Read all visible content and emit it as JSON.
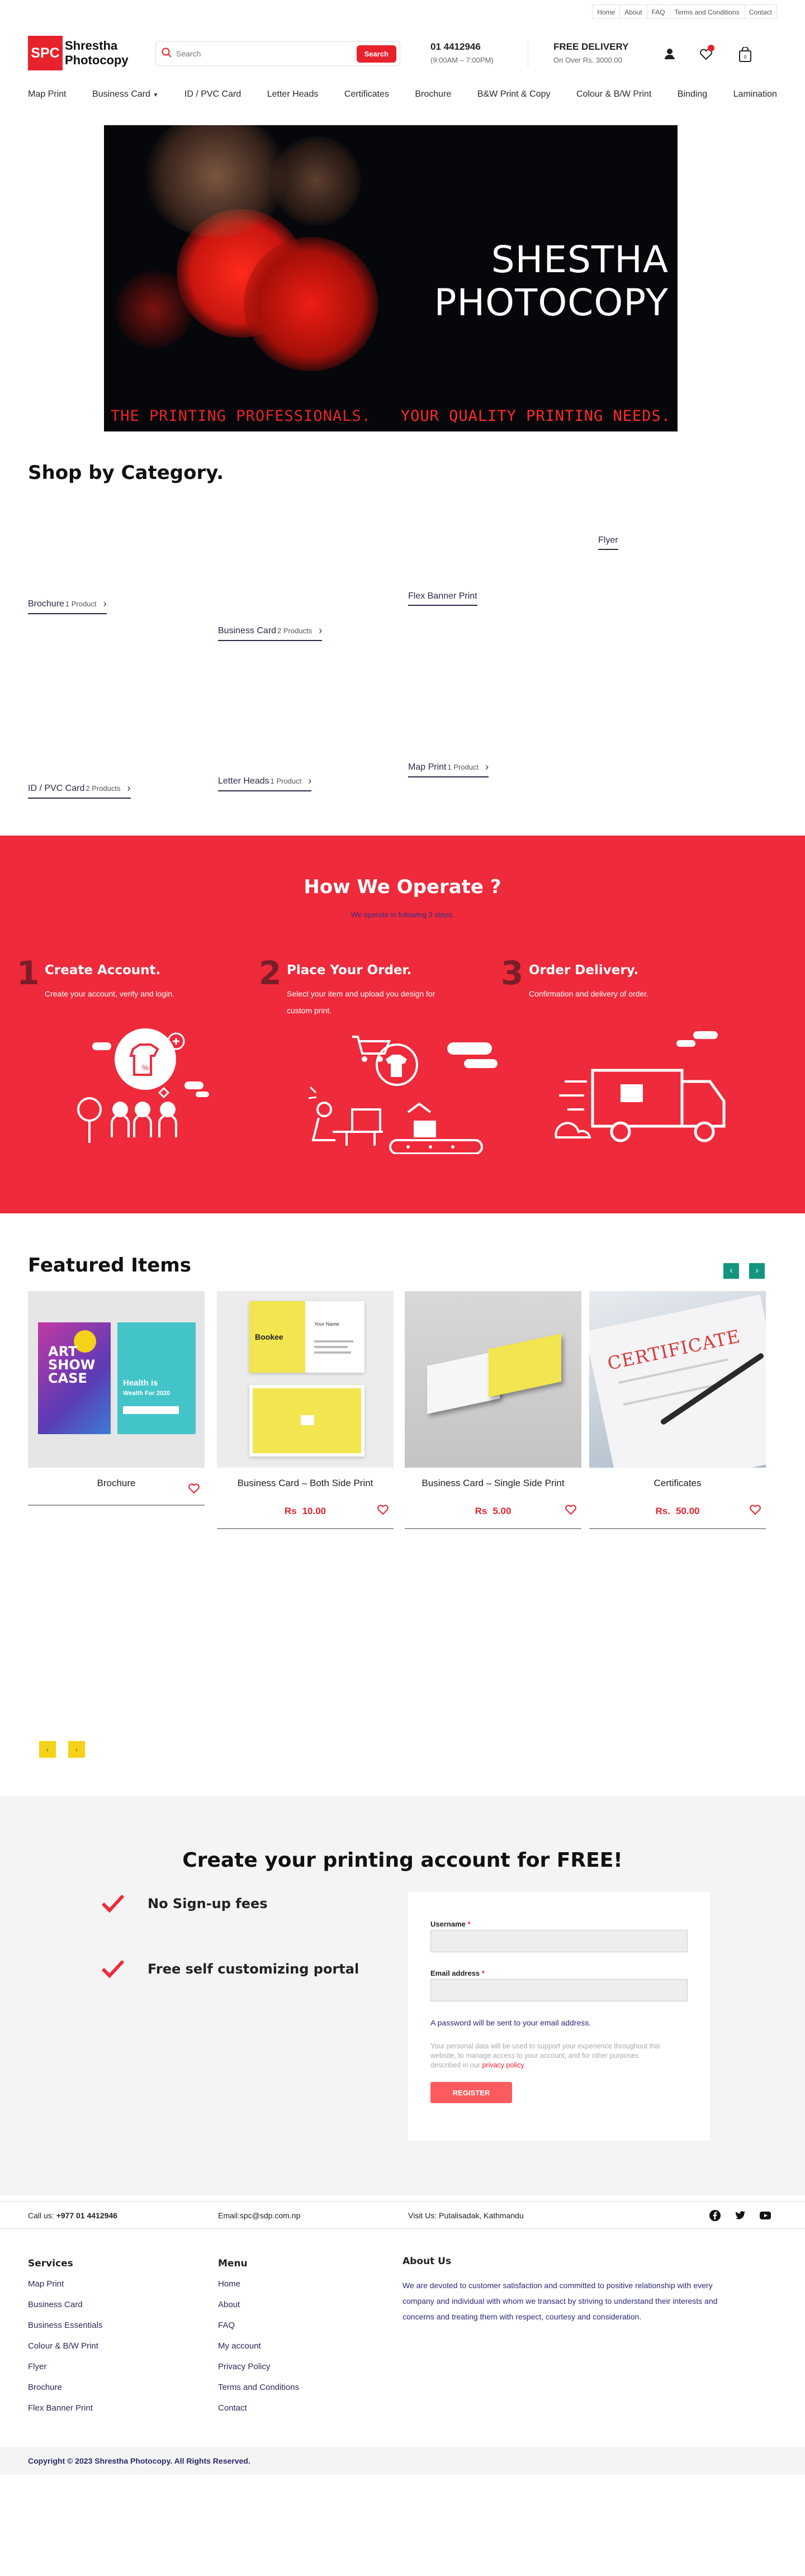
{
  "toplinks": [
    "Home",
    "About",
    "FAQ",
    "Terms and Conditions",
    "Contact"
  ],
  "logo": {
    "mark": "SPC",
    "line1": "Shrestha",
    "line2": "Photocopy"
  },
  "search": {
    "placeholder": "Search",
    "button": "Search"
  },
  "phone": {
    "number": "01 4412946",
    "hours": "(9:00AM – 7:00PM)"
  },
  "delivery": {
    "title": "FREE DELIVERY",
    "subtitle": "On Over Rs. 3000.00"
  },
  "nav": [
    "Map Print",
    "Business Card",
    "ID / PVC Card",
    "Letter Heads",
    "Certificates",
    "Brochure",
    "B&W Print & Copy",
    "Colour & B/W Print",
    "Binding",
    "Lamination"
  ],
  "banner": {
    "title": "SHESTHA PHOTOCOPY",
    "tagline_left": "THE PRINTING PROFESSIONALS.",
    "tagline_right": "YOUR QUALITY PRINTING NEEDS."
  },
  "categories": {
    "title": "Shop by Category.",
    "items": [
      {
        "name": "Flyer",
        "count": ""
      },
      {
        "name": "Brochure",
        "count": "1 Product"
      },
      {
        "name": "Business Card",
        "count": "2 Products"
      },
      {
        "name": "Flex Banner Print",
        "count": ""
      },
      {
        "name": "ID / PVC Card",
        "count": "2 Products"
      },
      {
        "name": "Letter Heads",
        "count": "1 Product"
      },
      {
        "name": "Map Print",
        "count": "1 Product"
      }
    ]
  },
  "how": {
    "title": "How We Operate ?",
    "subtitle": "We operate in following 3 steps.",
    "steps": [
      {
        "num": "1",
        "title": "Create Account.",
        "desc": "Create your account, verify and login."
      },
      {
        "num": "2",
        "title": "Place Your Order.",
        "desc": "Select your item and upload you design for custom print."
      },
      {
        "num": "3",
        "title": "Order Delivery.",
        "desc": "Confirmation and delivery of order."
      }
    ]
  },
  "featured": {
    "title": "Featured Items",
    "items": [
      {
        "name": "Brochure",
        "currency": "",
        "price": ""
      },
      {
        "name": "Business Card – Both Side Print",
        "currency": "Rs",
        "price": "10.00"
      },
      {
        "name": "Business Card – Single Side Print",
        "currency": "Rs",
        "price": "5.00"
      },
      {
        "name": "Certificates",
        "currency": "Rs.",
        "price": "50.00"
      }
    ],
    "brochure_art": {
      "l1": "ART",
      "l2": "SHOW",
      "l3": "CASE",
      "r1": "Health is",
      "r2": "Wealth For 2020"
    },
    "card_brand": "Bookee",
    "card_person": "Your Name",
    "certificate_word": "CERTIFICATE"
  },
  "signup": {
    "title": "Create your printing account for FREE!",
    "perks": [
      "No Sign-up fees",
      "Free self customizing portal"
    ],
    "username_label": "Username",
    "email_label": "Email address",
    "required": "*",
    "note": "A password will be sent to your email address.",
    "privacy_text": "Your personal data will be used to support your experience throughout this website, to manage access to your account, and for other purposes described in our",
    "privacy_link": "privacy policy",
    "privacy_end": ".",
    "register": "REGISTER"
  },
  "contact": {
    "call_label": "Call us:",
    "call": "+977 01 4412946",
    "email": "Email:spc@sdp.com.np",
    "visit": "Visit Us: Putalisadak, Kathmandu"
  },
  "footer": {
    "services_title": "Services",
    "services": [
      "Map Print",
      "Business Card",
      "Business Essentials",
      "Colour & B/W Print",
      "Flyer",
      "Brochure",
      "Flex Banner Print"
    ],
    "menu_title": "Menu",
    "menu": [
      "Home",
      "About",
      "FAQ",
      "My account",
      "Privacy Policy",
      "Terms and Conditions",
      "Contact"
    ],
    "about_title": "About Us",
    "about_text": "We are devoted to customer satisfaction and committed to positive relationship with every company and individual with whom we transact by striving to understand their interests and concerns and treating them with respect, courtesy and consideration.",
    "copyright": "Copyright © 2023 Shrestha Photocopy. All Rights Reserved."
  },
  "colors": {
    "brand_red": "#e8222d",
    "how_bg": "#ee2a3b",
    "teal": "#14967e",
    "yellow": "#f5d21a"
  }
}
